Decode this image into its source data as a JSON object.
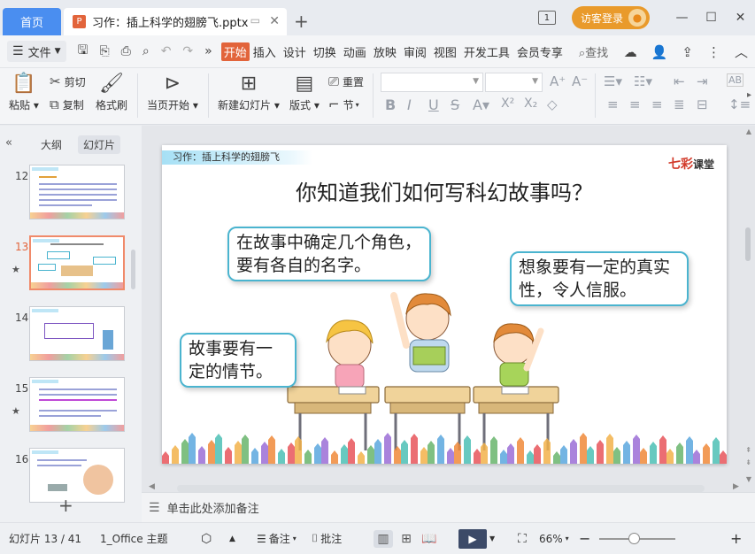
{
  "titlebar": {
    "home_tab": "首页",
    "doc_tab": "习作：插上科学的翅膀飞.pptx",
    "doc_icon": "P",
    "add_tab": "+",
    "page_indicator": "1",
    "login": "访客登录"
  },
  "menubar": {
    "file": "文件",
    "items": [
      "开始",
      "插入",
      "设计",
      "切换",
      "动画",
      "放映",
      "审阅",
      "视图",
      "开发工具",
      "会员专享"
    ],
    "search": "查找"
  },
  "ribbon": {
    "paste": "粘贴",
    "cut": "剪切",
    "copy": "复制",
    "format_painter": "格式刷",
    "from_current": "当页开始",
    "new_slide": "新建幻灯片",
    "layout": "版式",
    "reset": "重置",
    "section": "节",
    "font_name": "",
    "font_size": ""
  },
  "left_panel": {
    "outline_tab": "大纲",
    "slides_tab": "幻灯片",
    "thumbnails": [
      {
        "num": "12",
        "starred": false,
        "current": false
      },
      {
        "num": "13",
        "starred": true,
        "current": true
      },
      {
        "num": "14",
        "starred": false,
        "current": false
      },
      {
        "num": "15",
        "starred": true,
        "current": false
      },
      {
        "num": "16",
        "starred": false,
        "current": false
      }
    ]
  },
  "slide": {
    "tag": "习作：插上科学的翅膀飞",
    "logo_main": "七彩",
    "logo_sub": "课堂",
    "title": "你知道我们如何写科幻故事吗？",
    "bubble_1": "在故事中确定几个角色，要有各自的名字。",
    "bubble_2": "想象要有一定的真实性，令人信服。",
    "bubble_3": "故事要有一定的情节。"
  },
  "notes": {
    "placeholder": "单击此处添加备注"
  },
  "statusbar": {
    "slide_count": "幻灯片 13 / 41",
    "theme": "1_Office 主题",
    "notes": "备注",
    "comments": "批注",
    "zoom": "66%",
    "zoom_level": 0.45
  },
  "colors": {
    "accent": "#4a8ef0",
    "start_tab": "#e2643b",
    "bubble_border": "#4ab4cf",
    "login": "#e99a2b"
  }
}
